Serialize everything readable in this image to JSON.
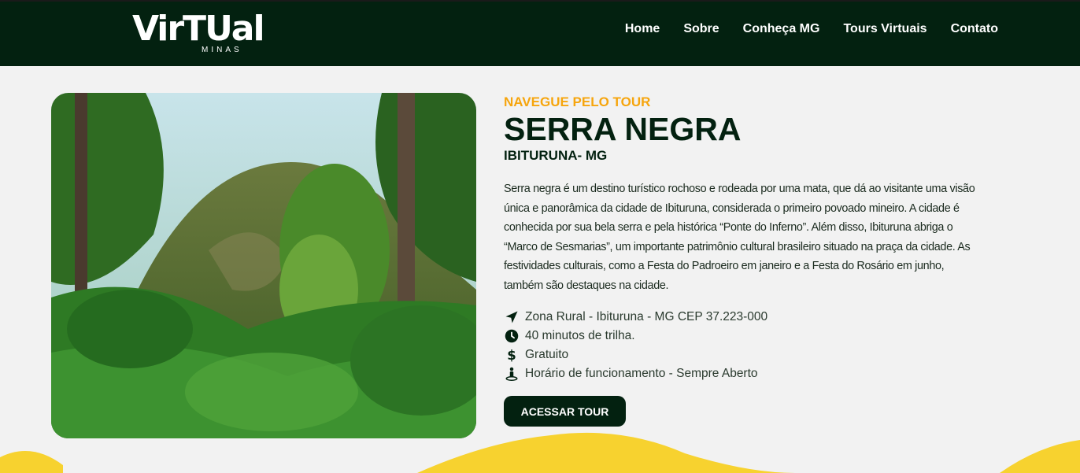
{
  "header": {
    "logo": {
      "main": "VirTUal",
      "sub": "MINAS"
    },
    "nav": [
      {
        "label": "Home"
      },
      {
        "label": "Sobre"
      },
      {
        "label": "Conheça MG"
      },
      {
        "label": "Tours Virtuais"
      },
      {
        "label": "Contato"
      }
    ]
  },
  "hero": {
    "image_alt": "forest-mountain-photo"
  },
  "content": {
    "eyebrow": "NAVEGUE PELO TOUR",
    "title": "SERRA NEGRA",
    "subtitle": "IBITURUNA- MG",
    "description": "Serra negra é um destino turístico rochoso e rodeada por uma mata, que dá ao visitante uma visão única e panorâmica da cidade de Ibituruna, considerada o primeiro povoado mineiro.  A cidade é conhecida por sua bela serra e pela histórica “Ponte do Inferno”. Além disso, Ibituruna abriga o “Marco de Sesmarias”, um importante patrimônio cultural brasileiro situado na praça da cidade. As festividades culturais, como a Festa do Padroeiro em janeiro e a Festa do Rosário em junho, também são destaques na cidade.",
    "info": [
      {
        "icon": "location-arrow-icon",
        "text": "Zona Rural - Ibituruna - MG CEP 37.223-000"
      },
      {
        "icon": "clock-icon",
        "text": "40 minutos de trilha."
      },
      {
        "icon": "dollar-icon",
        "text": "Gratuito"
      },
      {
        "icon": "person-pin-icon",
        "text": "Horário de funcionamento - Sempre Aberto"
      }
    ],
    "cta_label": "ACESSAR TOUR"
  },
  "colors": {
    "dark_green": "#032110",
    "accent_yellow": "#f6a50d",
    "wave_yellow": "#f7d22f",
    "background": "#f2f2f2"
  }
}
